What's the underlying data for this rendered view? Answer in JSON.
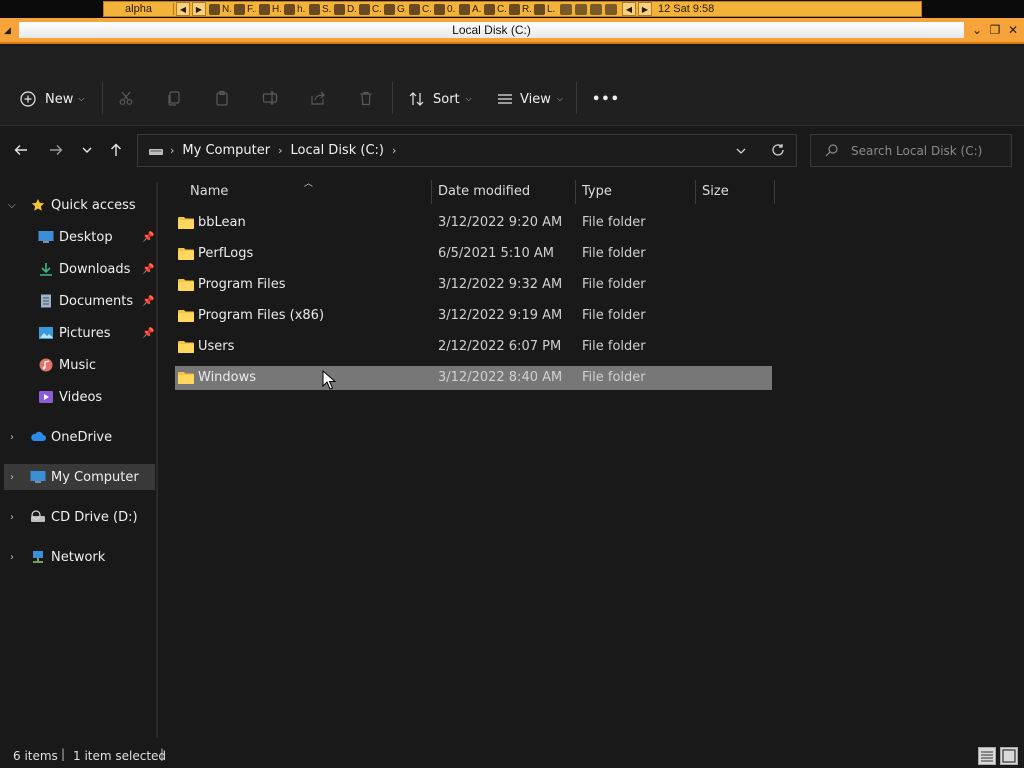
{
  "taskbar": {
    "workspace": "alpha",
    "tasks": [
      "N..",
      "F...",
      "H...",
      "h...",
      "S...",
      "D...",
      "C...",
      "G...",
      "C...",
      "0...",
      "A...",
      "C...",
      "R...",
      "L..."
    ],
    "clock": "12 Sat 9:58"
  },
  "window": {
    "title": "Local Disk (C:)"
  },
  "command_bar": {
    "new_label": "New",
    "sort_label": "Sort",
    "view_label": "View",
    "more_label": "•••"
  },
  "address": {
    "segments": [
      "My Computer",
      "Local Disk (C:)"
    ],
    "search_placeholder": "Search Local Disk (C:)"
  },
  "sidebar": {
    "quick_access": "Quick access",
    "items": [
      {
        "label": "Desktop"
      },
      {
        "label": "Downloads"
      },
      {
        "label": "Documents"
      },
      {
        "label": "Pictures"
      },
      {
        "label": "Music"
      },
      {
        "label": "Videos"
      },
      {
        "label": "OneDrive"
      },
      {
        "label": "My Computer"
      },
      {
        "label": "CD Drive (D:)"
      },
      {
        "label": "Network"
      }
    ]
  },
  "columns": {
    "name": "Name",
    "date": "Date modified",
    "type": "Type",
    "size": "Size"
  },
  "files": [
    {
      "name": "bbLean",
      "date": "3/12/2022 9:20 AM",
      "type": "File folder"
    },
    {
      "name": "PerfLogs",
      "date": "6/5/2021 5:10 AM",
      "type": "File folder"
    },
    {
      "name": "Program Files",
      "date": "3/12/2022 9:32 AM",
      "type": "File folder"
    },
    {
      "name": "Program Files (x86)",
      "date": "3/12/2022 9:19 AM",
      "type": "File folder"
    },
    {
      "name": "Users",
      "date": "2/12/2022 6:07 PM",
      "type": "File folder"
    },
    {
      "name": "Windows",
      "date": "3/12/2022 8:40 AM",
      "type": "File folder"
    }
  ],
  "status": {
    "items": "6 items",
    "selected": "1 item selected"
  },
  "colors": {
    "accent_orange": "#f6a33a",
    "background": "#191919",
    "selection": "#777777",
    "folder": "#f5c542"
  }
}
